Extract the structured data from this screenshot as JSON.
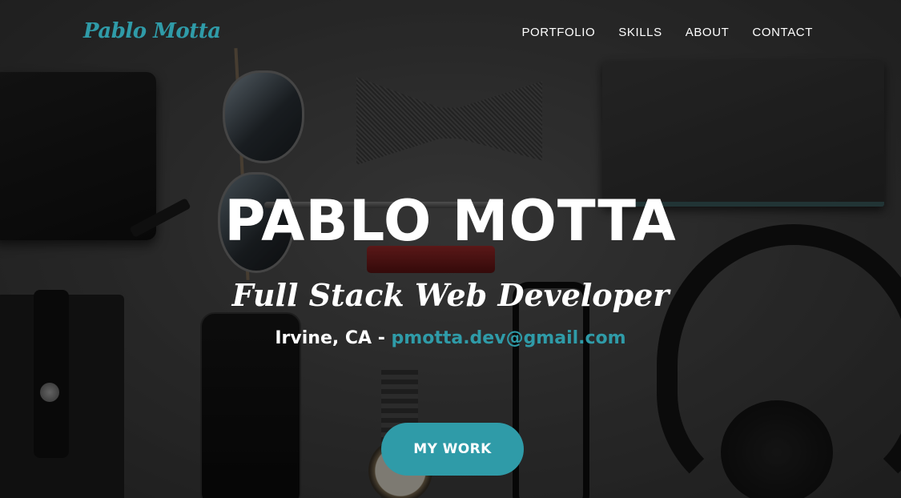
{
  "brand": "Pablo Motta",
  "nav": {
    "items": [
      {
        "label": "PORTFOLIO"
      },
      {
        "label": "SKILLS"
      },
      {
        "label": "ABOUT"
      },
      {
        "label": "CONTACT"
      }
    ]
  },
  "hero": {
    "name": "PABLO MOTTA",
    "title": "Full Stack Web Developer",
    "location": "Irvine, CA",
    "separator": " - ",
    "email": "pmotta.dev@gmail.com",
    "cta_label": "MY WORK"
  },
  "colors": {
    "accent": "#2f9ba8",
    "text": "#ffffff",
    "overlay": "rgba(0,0,0,0.42)"
  }
}
